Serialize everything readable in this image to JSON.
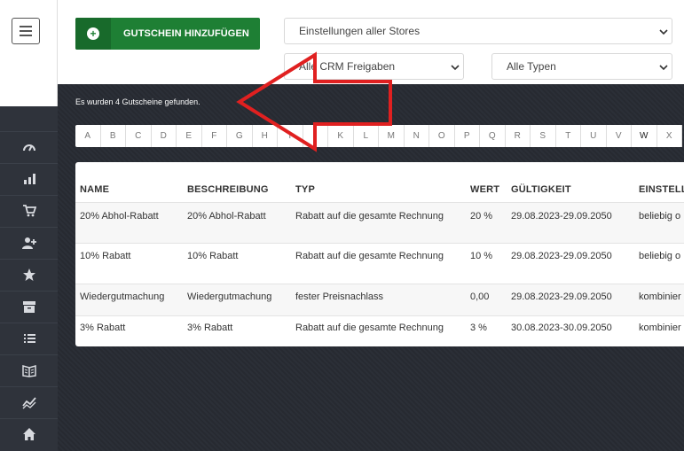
{
  "toolbar": {
    "add_button_label": "GUTSCHEIN HINZUFÜGEN",
    "store_select_value": "Einstellungen aller Stores",
    "crm_select_value": "Alle CRM Freigaben",
    "type_select_value": "Alle Typen"
  },
  "main": {
    "found_text": "Es wurden 4 Gutscheine gefunden.",
    "alphabet": [
      "A",
      "B",
      "C",
      "D",
      "E",
      "F",
      "G",
      "H",
      "I",
      "J",
      "K",
      "L",
      "M",
      "N",
      "O",
      "P",
      "Q",
      "R",
      "S",
      "T",
      "U",
      "V",
      "W",
      "X"
    ]
  },
  "table": {
    "headers": {
      "name": "NAME",
      "beschreibung": "BESCHREIBUNG",
      "typ": "TYP",
      "wert": "WERT",
      "gueltigkeit": "GÜLTIGKEIT",
      "einstellungen": "EINSTELL"
    },
    "rows": [
      {
        "name": "20% Abhol-Rabatt",
        "beschreibung": "20% Abhol-Rabatt",
        "typ": "Rabatt auf die gesamte Rechnung",
        "wert": "20 %",
        "gueltigkeit": "29.08.2023-29.09.2050",
        "einstellungen": "beliebig o"
      },
      {
        "name": "10% Rabatt",
        "beschreibung": "10% Rabatt",
        "typ": "Rabatt auf die gesamte Rechnung",
        "wert": "10 %",
        "gueltigkeit": "29.08.2023-29.09.2050",
        "einstellungen": "beliebig o"
      },
      {
        "name": "Wiedergutmachung",
        "beschreibung": "Wiedergutmachung",
        "typ": "fester Preisnachlass",
        "wert": "0,00",
        "gueltigkeit": "29.08.2023-29.09.2050",
        "einstellungen": "kombinier"
      },
      {
        "name": "3% Rabatt",
        "beschreibung": "3% Rabatt",
        "typ": "Rabatt auf die gesamte Rechnung",
        "wert": "3 %",
        "gueltigkeit": "30.08.2023-30.09.2050",
        "einstellungen": "kombinier"
      }
    ]
  },
  "sidebar": {
    "icons": [
      "gauge-icon",
      "bar-chart-icon",
      "cart-icon",
      "add-user-icon",
      "star-icon",
      "archive-icon",
      "list-icon",
      "book-icon",
      "trend-icon",
      "home-icon"
    ]
  },
  "colors": {
    "primary_green": "#1e7f34",
    "sidebar_bg": "#2f333b",
    "arrow_red": "#e02020"
  }
}
